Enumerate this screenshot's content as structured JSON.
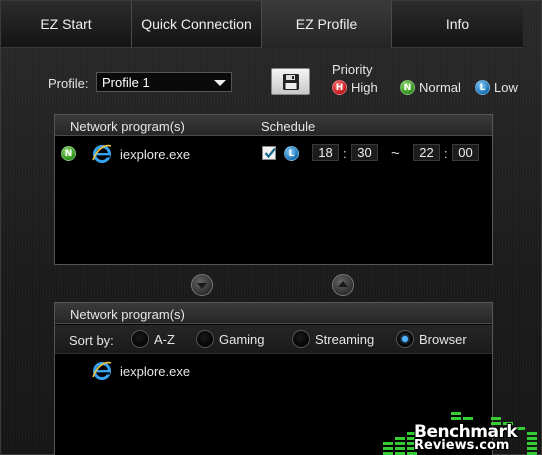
{
  "tabs": [
    {
      "label": "EZ Start"
    },
    {
      "label": "Quick Connection"
    },
    {
      "label": "EZ Profile",
      "active": true
    },
    {
      "label": "Info"
    }
  ],
  "toolbar": {
    "profile_label": "Profile:",
    "profile_value": "Profile 1",
    "save_icon": "floppy-disk-icon"
  },
  "priority": {
    "title": "Priority",
    "high": {
      "badge": "H",
      "label": "High",
      "color": "#c1121c"
    },
    "normal": {
      "badge": "N",
      "label": "Normal",
      "color": "#2c8f1a"
    },
    "low": {
      "badge": "L",
      "label": "Low",
      "color": "#136fb3"
    }
  },
  "scheduled_panel": {
    "header_program": "Network program(s)",
    "header_schedule": "Schedule",
    "rows": [
      {
        "priority_badge": "N",
        "icon": "internet-explorer-icon",
        "name": "iexplore.exe",
        "schedule_enabled": true,
        "schedule_priority_badge": "L",
        "start_hour": "18",
        "start_minute": "30",
        "separator": ":",
        "range_separator": "~",
        "end_hour": "22",
        "end_minute": "00"
      }
    ]
  },
  "available_panel": {
    "header_program": "Network program(s)",
    "sort_label": "Sort by:",
    "sort_options": [
      {
        "label": "A-Z",
        "selected": false
      },
      {
        "label": "Gaming",
        "selected": false
      },
      {
        "label": "Streaming",
        "selected": false
      },
      {
        "label": "Browser",
        "selected": true
      }
    ],
    "items": [
      {
        "icon": "internet-explorer-icon",
        "name": "iexplore.exe"
      }
    ]
  },
  "watermark": {
    "line1": "Benchmark",
    "line2": "Reviews.com"
  }
}
